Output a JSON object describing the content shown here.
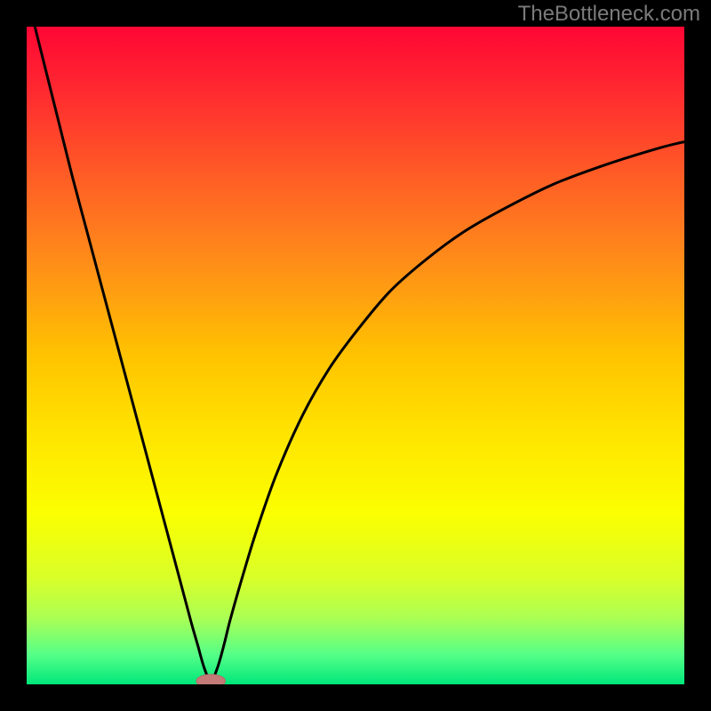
{
  "watermark": "TheBottleneck.com",
  "colors": {
    "frame": "#000000",
    "curve": "#000000",
    "marker_fill": "#c47b78",
    "marker_stroke": "#b56a67",
    "gradient": [
      {
        "offset": 0.0,
        "color": "#ff0634"
      },
      {
        "offset": 0.1,
        "color": "#ff2a30"
      },
      {
        "offset": 0.22,
        "color": "#ff5a26"
      },
      {
        "offset": 0.35,
        "color": "#ff8a1a"
      },
      {
        "offset": 0.5,
        "color": "#ffc300"
      },
      {
        "offset": 0.62,
        "color": "#ffe400"
      },
      {
        "offset": 0.74,
        "color": "#fbff00"
      },
      {
        "offset": 0.84,
        "color": "#d8ff2a"
      },
      {
        "offset": 0.9,
        "color": "#aaff55"
      },
      {
        "offset": 0.955,
        "color": "#55ff88"
      },
      {
        "offset": 1.0,
        "color": "#00e77a"
      }
    ]
  },
  "chart_data": {
    "type": "line",
    "title": "",
    "xlabel": "",
    "ylabel": "",
    "xlim": [
      0,
      100
    ],
    "ylim": [
      0,
      100
    ],
    "grid": false,
    "legend": false,
    "series": [
      {
        "name": "curve",
        "x": [
          1,
          3,
          5,
          7,
          9,
          11,
          13,
          15,
          17,
          19,
          21,
          23,
          25,
          26,
          27,
          28,
          29,
          30,
          31,
          33,
          35,
          38,
          42,
          46,
          50,
          55,
          60,
          66,
          72,
          80,
          88,
          96,
          100
        ],
        "y": [
          101,
          93,
          85,
          77,
          69.5,
          62,
          54.5,
          47,
          39.5,
          32,
          24.5,
          17,
          9.5,
          6,
          2.5,
          0.5,
          2.5,
          6,
          10,
          17,
          23.5,
          32,
          41,
          48,
          53.5,
          59.5,
          64,
          68.5,
          72,
          76,
          79,
          81.5,
          82.5
        ]
      }
    ],
    "marker": {
      "x": 28,
      "y": 0.5,
      "rx": 2.2,
      "ry": 1.0
    }
  }
}
